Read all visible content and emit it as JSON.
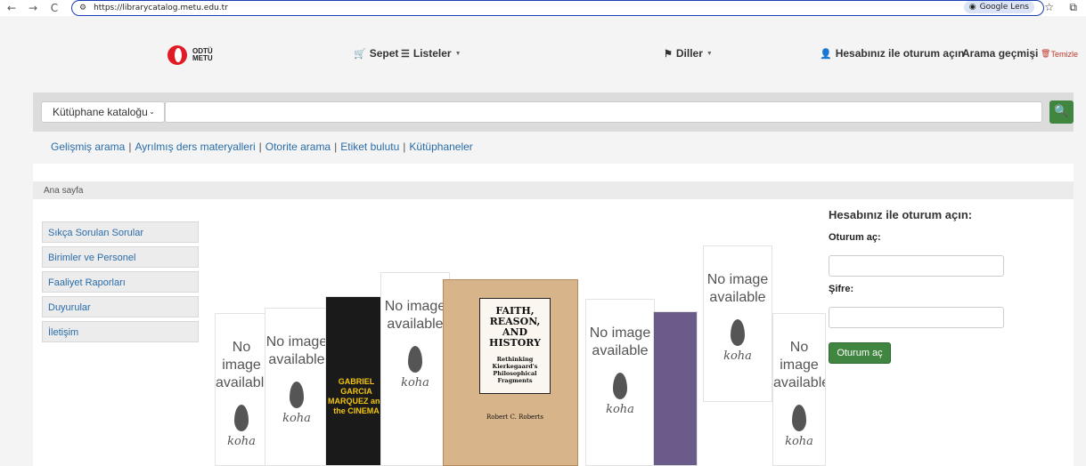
{
  "browser": {
    "url": "https://librarycatalog.metu.edu.tr",
    "lens_label": "Google Lens"
  },
  "header": {
    "logo_line1": "ODTÜ",
    "logo_line2": "METU",
    "cart_label": "Sepet",
    "lists_label": "Listeler",
    "languages_label": "Diller",
    "login_label": "Hesabınız ile oturum açın",
    "history_label": "Arama geçmişi",
    "clear_label": "Temizle"
  },
  "search": {
    "select_value": "Kütüphane kataloğu",
    "input_value": ""
  },
  "links": [
    "Gelişmiş arama",
    "Ayrılmış ders materyalleri",
    "Otorite arama",
    "Etiket bulutu",
    "Kütüphaneler"
  ],
  "breadcrumb": "Ana sayfa",
  "sidebar": {
    "items": [
      {
        "label": "Sıkça Sorulan Sorular"
      },
      {
        "label": "Birimler ve Personel"
      },
      {
        "label": "Faaliyet Raporları"
      },
      {
        "label": "Duyurular"
      },
      {
        "label": "İletişim"
      }
    ]
  },
  "carousel": {
    "no_image_line1": "No image",
    "no_image_line2": "available",
    "koha": "koha",
    "faith_title": "FAITH, REASON, AND HISTORY",
    "faith_subtitle": "Rethinking Kierkegaard's Philosophical Fragments",
    "faith_author": "Robert C. Roberts",
    "marquez_text": "GABRIEL GARCIA MARQUEZ and the CINEMA"
  },
  "login": {
    "heading": "Hesabınız ile oturum açın:",
    "user_label": "Oturum aç:",
    "password_label": "Şifre:",
    "button_label": "Oturum aç"
  },
  "colors": {
    "accent_green": "#408540",
    "link_blue": "#2a6ca8",
    "logo_red": "#e01b24"
  }
}
